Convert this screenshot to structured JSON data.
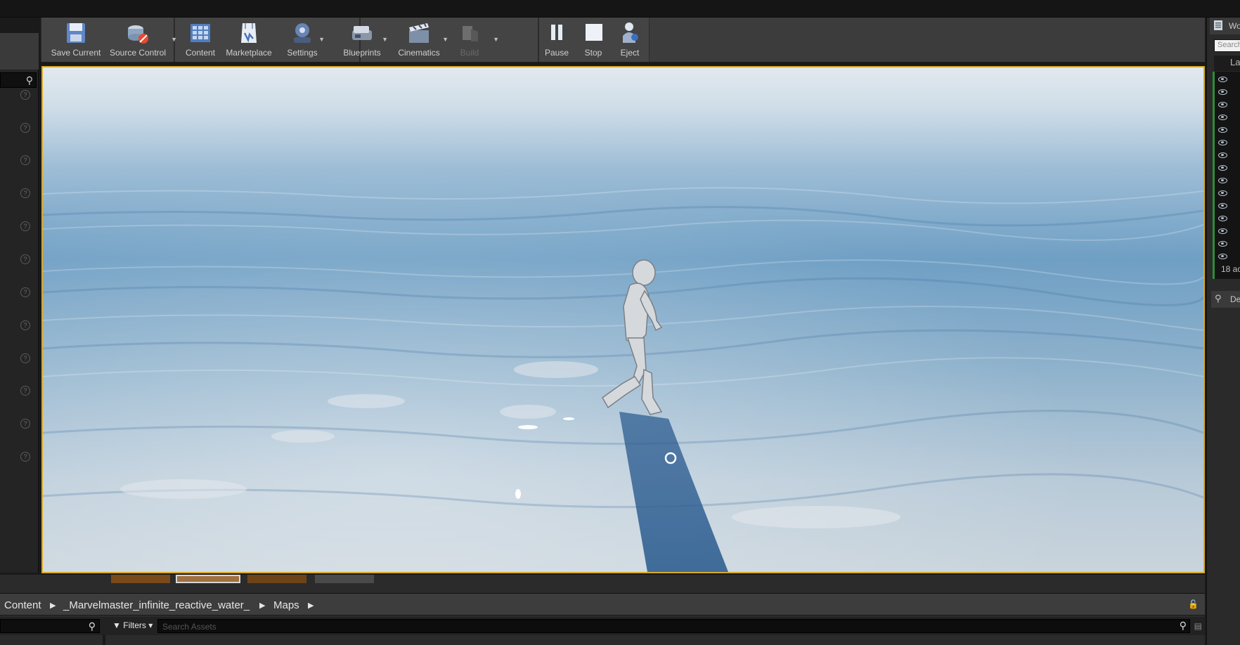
{
  "toolbar": {
    "save_current": "Save Current",
    "source_control": "Source Control",
    "content": "Content",
    "marketplace": "Marketplace",
    "settings": "Settings",
    "blueprints": "Blueprints",
    "cinematics": "Cinematics",
    "build": "Build",
    "pause": "Pause",
    "stop": "Stop",
    "eject": "Eject"
  },
  "world_outliner": {
    "tab_label": "Wo",
    "search_placeholder": "Search",
    "column_label": "Lab",
    "actor_count": "18 ac",
    "details_tab": "De"
  },
  "content_browser": {
    "breadcrumbs": [
      "Content",
      "_Marvelmaster_infinite_reactive_water_",
      "Maps"
    ],
    "filters_label": "Filters",
    "search_placeholder": "Search Assets"
  },
  "colors": {
    "viewport_border": "#d8a92a",
    "outliner_accent": "#2d8e36",
    "water": "#6f9fc4",
    "sky": "#dfe8ef"
  },
  "icons": [
    "save-icon",
    "source-control-icon",
    "content-icon",
    "marketplace-icon",
    "settings-icon",
    "blueprints-icon",
    "cinematics-icon",
    "build-icon",
    "pause-icon",
    "stop-icon",
    "eject-icon",
    "search-icon",
    "eye-icon",
    "lock-icon",
    "filter-icon"
  ]
}
